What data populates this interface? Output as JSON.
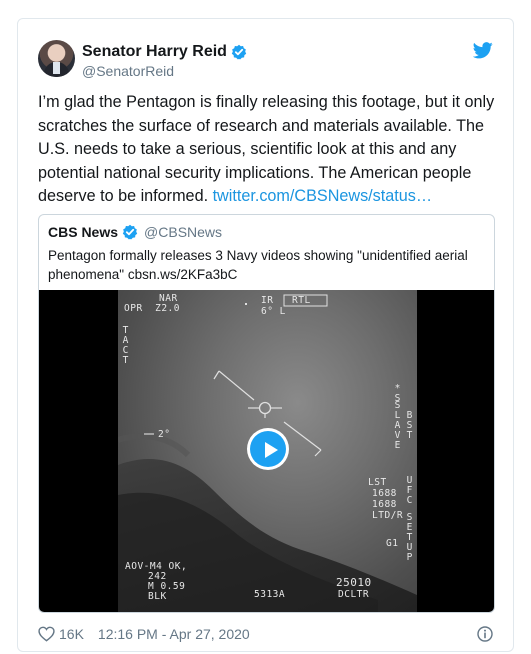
{
  "tweet": {
    "author_name": "Senator Harry Reid",
    "author_handle": "@SenatorReid",
    "text": "I’m glad the Pentagon is finally releasing this footage, but it only scratches the surface of research and materials available. The U.S. needs to take a serious, scientific look at this and any potential national security implications. The American people deserve to be informed. ",
    "link_text": "twitter.com/CBSNews/status…",
    "likes": "16K",
    "timestamp": "12:16 PM - Apr 27, 2020"
  },
  "quoted_tweet": {
    "author_name": "CBS News",
    "author_handle": "@CBSNews",
    "text": "Pentagon formally releases 3 Navy videos showing \"unidentified aerial phenomena\" cbsn.ws/2KFa3bC"
  },
  "video_overlay": {
    "nar": "NAR",
    "opr": "OPR  Z2.0",
    "ir": "IR",
    "rtl": "RTL",
    "six_l": "6° L",
    "tact": "TACT",
    "two_deg": "2°",
    "slave": "SLAVE",
    "lst": "LST",
    "n1688a": "1688",
    "n1688b": "1688",
    "ltd": "LTD/R",
    "g1": "G1",
    "aov": "AOV-M4 OK,",
    "n242": "242",
    "m059": "M 0.59",
    "blk": "BLK",
    "n5313a": "5313A",
    "n25010": "25010",
    "dcltr": "DCLTR",
    "star_s": "*S",
    "bst": "BST",
    "ufc": "UFC",
    "setup": "SETUP"
  },
  "colors": {
    "accent": "#1da1f2",
    "link": "#1b95e0",
    "secondary_text": "#657786",
    "border": "#e1e8ed"
  },
  "icons": [
    "verified-badge-icon",
    "twitter-bird-icon",
    "play-icon",
    "heart-icon",
    "info-icon"
  ]
}
